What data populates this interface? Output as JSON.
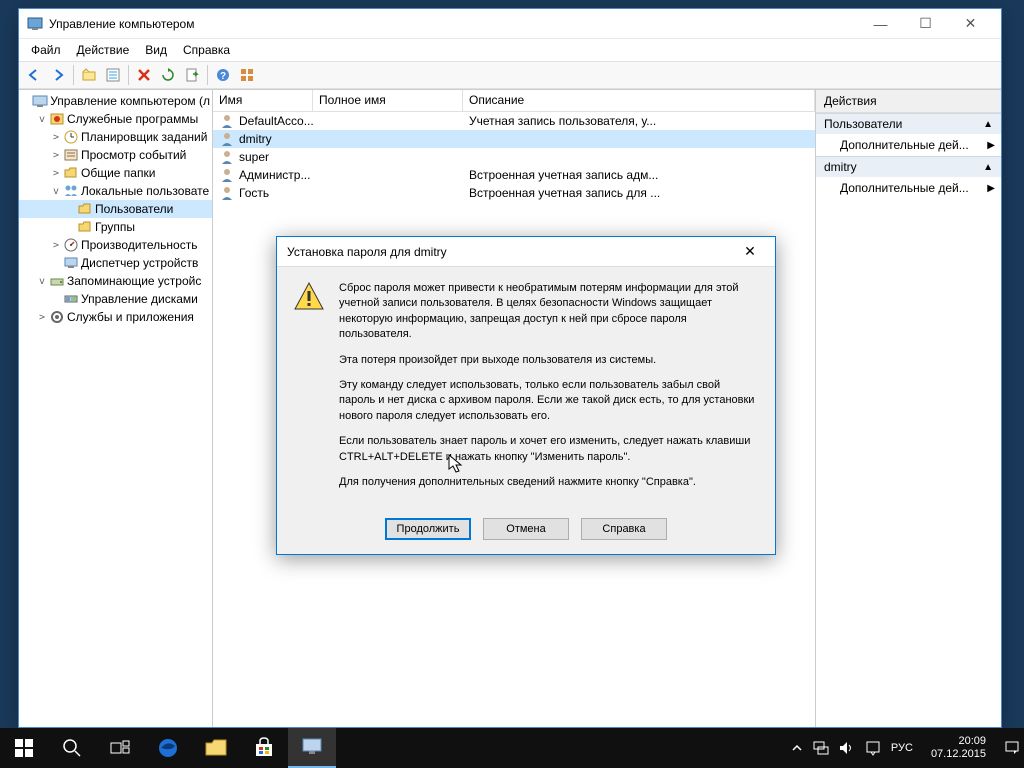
{
  "window": {
    "title": "Управление компьютером",
    "minimize": "—",
    "maximize": "☐",
    "close": "✕"
  },
  "menu": {
    "file": "Файл",
    "action": "Действие",
    "view": "Вид",
    "help": "Справка"
  },
  "tree": {
    "root": "Управление компьютером (л",
    "services": "Служебные программы",
    "scheduler": "Планировщик заданий",
    "eventviewer": "Просмотр событий",
    "sharedfolders": "Общие папки",
    "localusers": "Локальные пользовате",
    "users": "Пользователи",
    "groups": "Группы",
    "performance": "Производительность",
    "devicemgr": "Диспетчер устройств",
    "storage": "Запоминающие устройс",
    "diskmgmt": "Управление дисками",
    "servicesapps": "Службы и приложения"
  },
  "list": {
    "headers": {
      "name": "Имя",
      "fullname": "Полное имя",
      "description": "Описание"
    },
    "rows": [
      {
        "name": "DefaultAcco...",
        "fullname": "",
        "desc": "Учетная запись пользователя, у..."
      },
      {
        "name": "dmitry",
        "fullname": "",
        "desc": ""
      },
      {
        "name": "super",
        "fullname": "",
        "desc": ""
      },
      {
        "name": "Администр...",
        "fullname": "",
        "desc": "Встроенная учетная запись адм..."
      },
      {
        "name": "Гость",
        "fullname": "",
        "desc": "Встроенная учетная запись для ..."
      }
    ]
  },
  "actions": {
    "header": "Действия",
    "section1": "Пользователи",
    "moreactions": "Дополнительные дей...",
    "section2": "dmitry"
  },
  "dialog": {
    "title": "Установка пароля для dmitry",
    "p1": "Сброс пароля может привести к необратимым потерям информации для этой учетной записи пользователя. В целях безопасности Windows защищает некоторую информацию, запрещая доступ к ней при сбросе пароля пользователя.",
    "p2": "Эта потеря произойдет при выходе пользователя из системы.",
    "p3": "Эту команду следует использовать, только если пользователь забыл свой пароль и нет диска с архивом пароля. Если же такой диск есть, то для установки нового пароля следует использовать его.",
    "p4": "Если пользователь знает пароль и хочет его изменить, следует нажать клавиши CTRL+ALT+DELETE и нажать кнопку \"Изменить пароль\".",
    "p5": "Для получения дополнительных сведений нажмите кнопку \"Справка\".",
    "proceed": "Продолжить",
    "cancel": "Отмена",
    "help": "Справка"
  },
  "taskbar": {
    "lang": "РУС",
    "time": "20:09",
    "date": "07.12.2015"
  }
}
